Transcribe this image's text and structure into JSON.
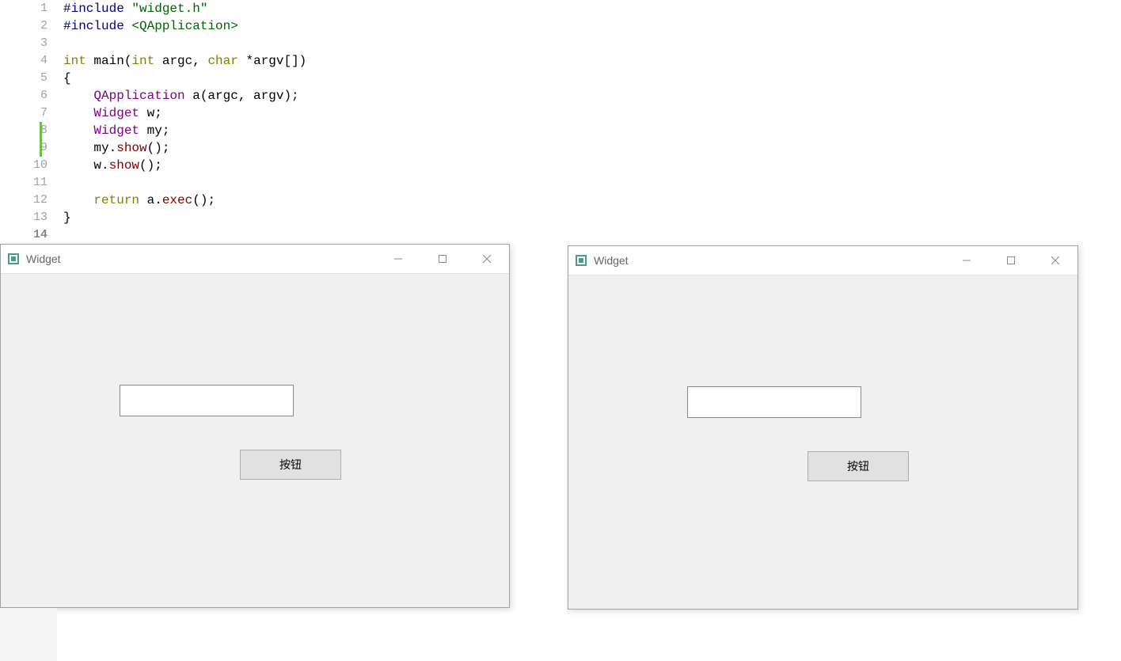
{
  "code": {
    "lines": [
      "1",
      "2",
      "3",
      "4",
      "5",
      "6",
      "7",
      "8",
      "9",
      "10",
      "11",
      "12",
      "13",
      "14"
    ],
    "l1_preproc": "#include",
    "l1_str": " \"widget.h\"",
    "l2_preproc": "#include",
    "l2_inc": " <QApplication>",
    "l4_type1": "int",
    "l4_ident1": " main(",
    "l4_type2": "int",
    "l4_ident2": " argc, ",
    "l4_type3": "char",
    "l4_ident3": " *argv[])",
    "l5": "{",
    "l6_class": "    QApplication",
    "l6_rest": " a(argc, argv);",
    "l7_class": "    Widget",
    "l7_rest": " w;",
    "l8_class": "    Widget",
    "l8_rest": " my;",
    "l9_obj": "    my.",
    "l9_method": "show",
    "l9_rest": "();",
    "l10_obj": "    w.",
    "l10_method": "show",
    "l10_rest": "();",
    "l12_kw": "    return",
    "l12_obj": " a.",
    "l12_method": "exec",
    "l12_rest": "();",
    "l13": "}"
  },
  "window1": {
    "title": "Widget",
    "button_label": "按钮",
    "input_value": ""
  },
  "window2": {
    "title": "Widget",
    "button_label": "按钮",
    "input_value": ""
  }
}
